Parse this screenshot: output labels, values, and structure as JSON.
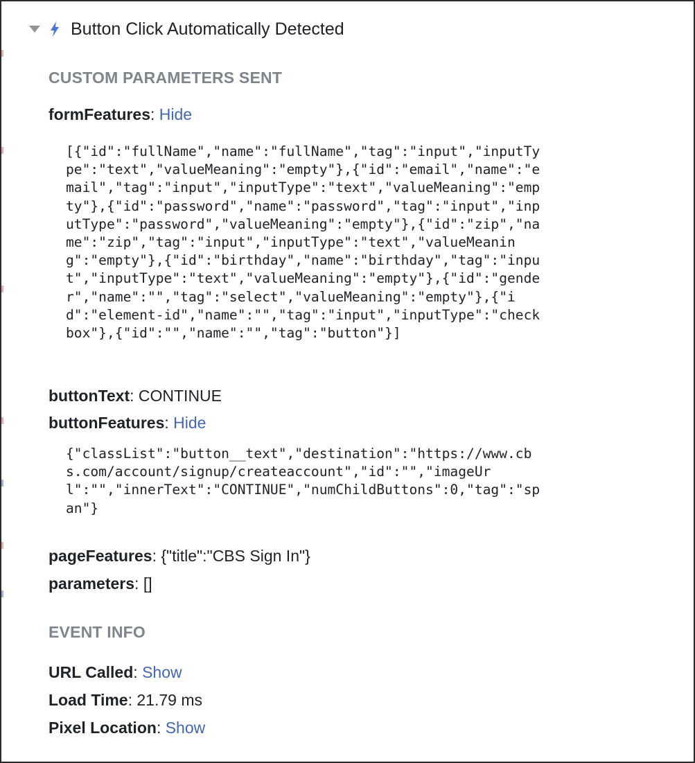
{
  "event": {
    "title": "Button Click Automatically Detected",
    "icon": "bolt-icon",
    "expanded": true
  },
  "custom_parameters": {
    "heading": "CUSTOM PARAMETERS SENT",
    "form_features": {
      "key": "formFeatures",
      "toggle": "Hide",
      "value_lines": [
        "[{\"id\":\"fullName\",\"name\":\"fullName\",\"tag\":\"input\",\"inputTy",
        "pe\":\"text\",\"valueMeaning\":\"empty\"},{\"id\":\"email\",\"name\":\"e",
        "mail\",\"tag\":\"input\",\"inputType\":\"text\",\"valueMeaning\":\"emp",
        "ty\"},{\"id\":\"password\",\"name\":\"password\",\"tag\":\"input\",\"inp",
        "utType\":\"password\",\"valueMeaning\":\"empty\"},{\"id\":\"zip\",\"na",
        "me\":\"zip\",\"tag\":\"input\",\"inputType\":\"text\",\"valueMeanin",
        "g\":\"empty\"},{\"id\":\"birthday\",\"name\":\"birthday\",\"tag\":\"inpu",
        "t\",\"inputType\":\"text\",\"valueMeaning\":\"empty\"},{\"id\":\"gende",
        "r\",\"name\":\"\",\"tag\":\"select\",\"valueMeaning\":\"empty\"},{\"i",
        "d\":\"element-id\",\"name\":\"\",\"tag\":\"input\",\"inputType\":\"check",
        "box\"},{\"id\":\"\",\"name\":\"\",\"tag\":\"button\"}]"
      ]
    },
    "button_text": {
      "key": "buttonText",
      "value": "CONTINUE"
    },
    "button_features": {
      "key": "buttonFeatures",
      "toggle": "Hide",
      "value_lines": [
        "{\"classList\":\"button__text\",\"destination\":\"https://www.cb",
        "s.com/account/signup/createaccount\",\"id\":\"\",\"imageUr",
        "l\":\"\",\"innerText\":\"CONTINUE\",\"numChildButtons\":0,\"tag\":\"sp",
        "an\"}"
      ]
    },
    "page_features": {
      "key": "pageFeatures",
      "value": "{\"title\":\"CBS Sign In\"}"
    },
    "parameters": {
      "key": "parameters",
      "value": "[]"
    }
  },
  "event_info": {
    "heading": "EVENT INFO",
    "url_called": {
      "key": "URL Called",
      "toggle": "Show"
    },
    "load_time": {
      "key": "Load Time",
      "value": "21.79 ms"
    },
    "pixel_location": {
      "key": "Pixel Location",
      "toggle": "Show"
    }
  },
  "colors": {
    "link": "#4267b2",
    "bolt": "#4a76d6",
    "heading": "#7f858d",
    "text": "#1d2129"
  }
}
